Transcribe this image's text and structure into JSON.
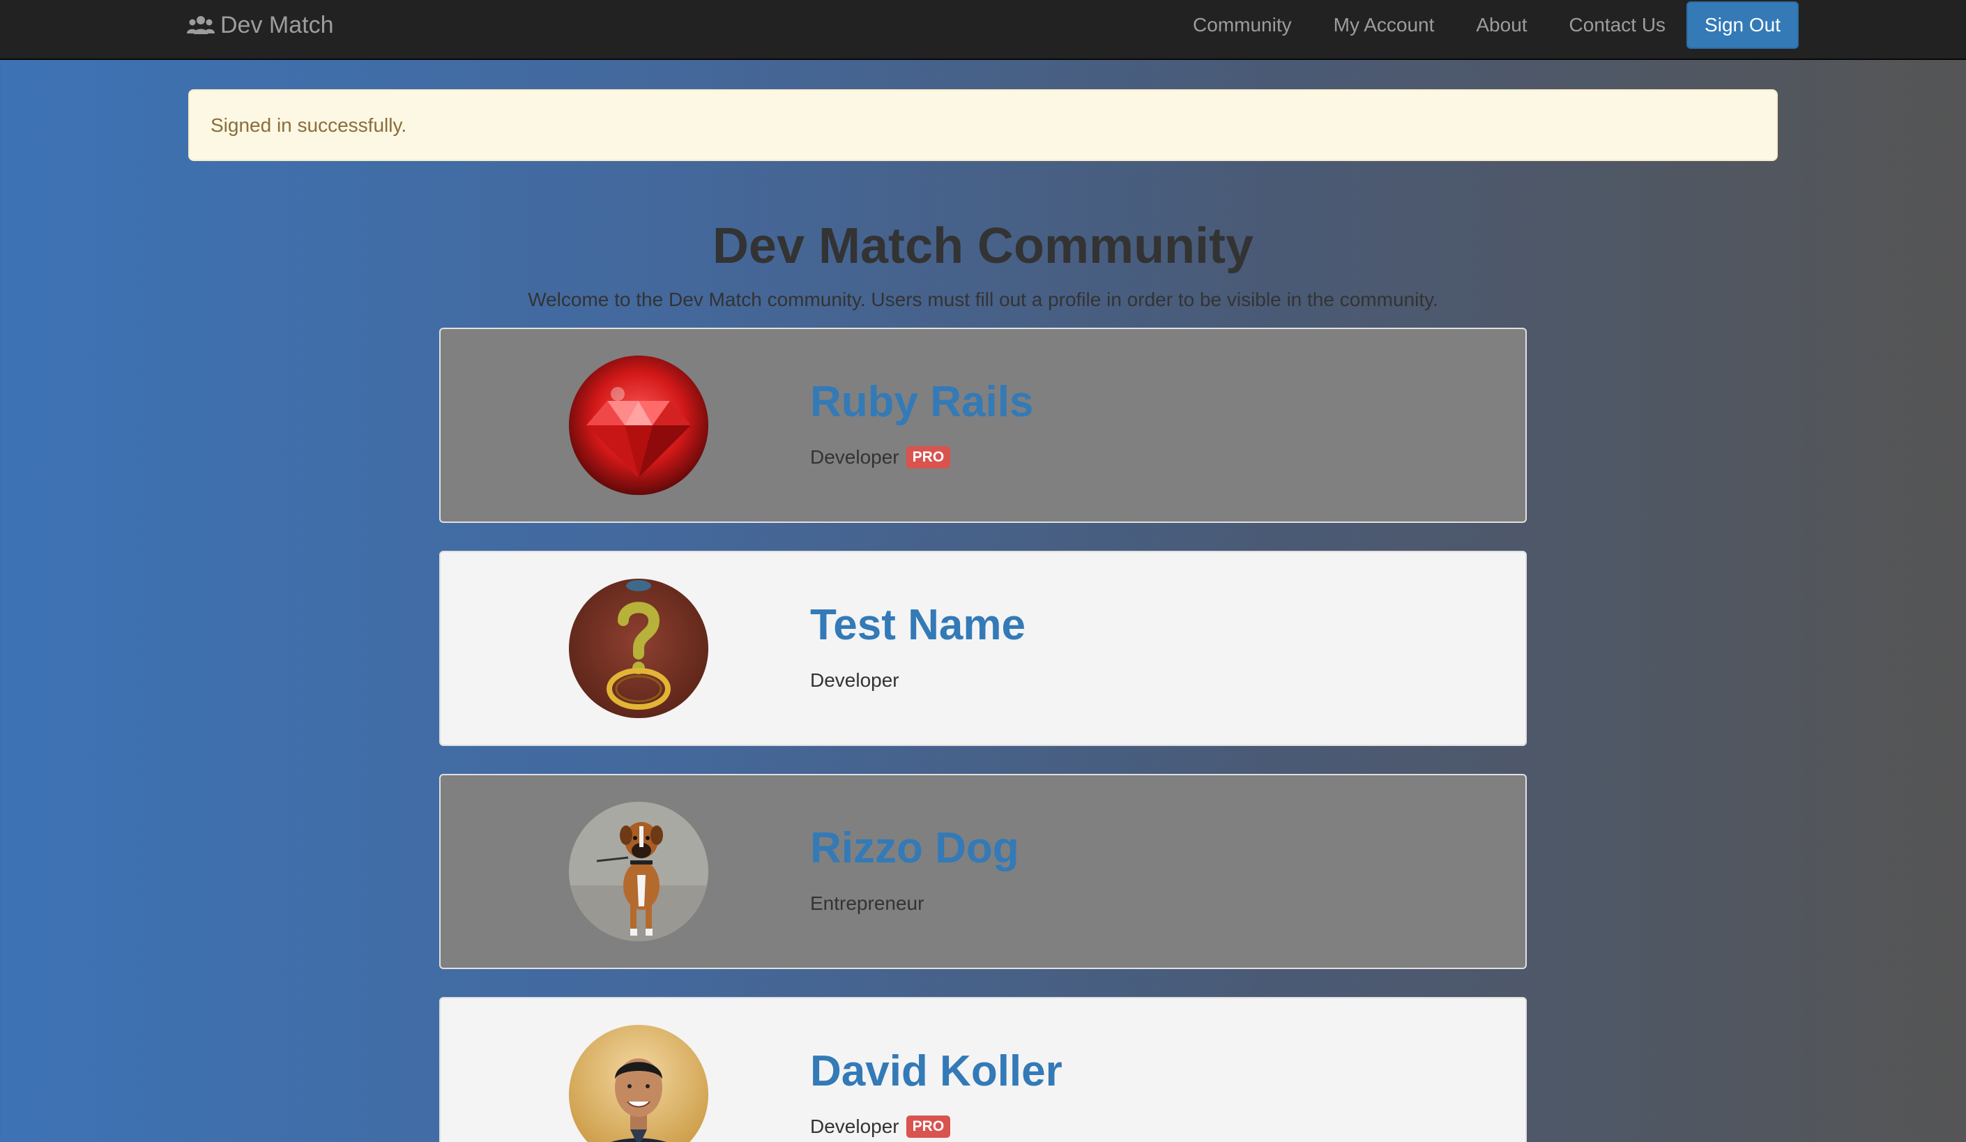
{
  "navbar": {
    "brand": "Dev Match",
    "brand_icon": "users-icon",
    "links": [
      "Community",
      "My Account",
      "About",
      "Contact Us"
    ],
    "sign_out": "Sign Out"
  },
  "alert": {
    "message": "Signed in successfully."
  },
  "page": {
    "title": "Dev Match Community",
    "subtitle": "Welcome to the Dev Match community. Users must fill out a profile in order to be visible in the community."
  },
  "profiles": [
    {
      "name": "Ruby Rails",
      "role": "Developer",
      "badge": "PRO",
      "avatar": "ruby-gem-avatar"
    },
    {
      "name": "Test Name",
      "role": "Developer",
      "badge": "",
      "avatar": "question-mark-avatar"
    },
    {
      "name": "Rizzo Dog",
      "role": "Entrepreneur",
      "badge": "",
      "avatar": "dog-avatar"
    },
    {
      "name": "David Koller",
      "role": "Developer",
      "badge": "PRO",
      "avatar": "person-avatar"
    }
  ],
  "colors": {
    "navbar_bg": "#222222",
    "primary": "#337ab7",
    "alert_bg": "#fcf8e3",
    "alert_text": "#8a6d3b",
    "pro_badge": "#d9534f",
    "card_dark": "#808080",
    "card_light": "#f4f4f4"
  }
}
